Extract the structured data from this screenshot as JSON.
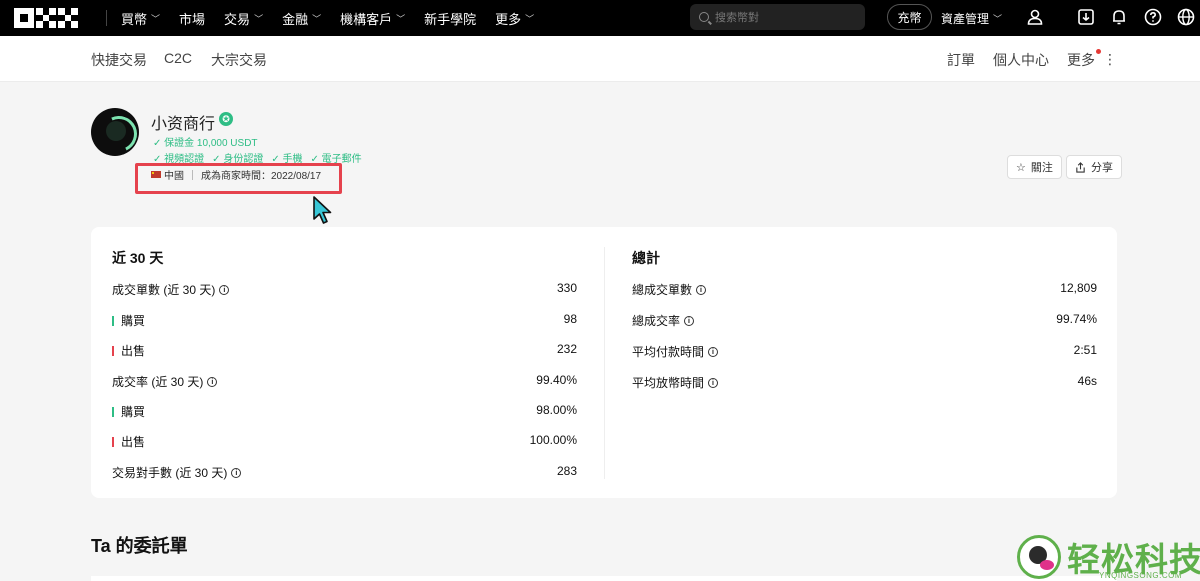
{
  "topnav": {
    "menu": [
      {
        "label": "買幣",
        "dropdown": true
      },
      {
        "label": "市場",
        "dropdown": false
      },
      {
        "label": "交易",
        "dropdown": true
      },
      {
        "label": "金融",
        "dropdown": true
      },
      {
        "label": "機構客戶",
        "dropdown": true
      },
      {
        "label": "新手學院",
        "dropdown": false
      },
      {
        "label": "更多",
        "dropdown": true
      }
    ],
    "search_placeholder": "搜索幣對",
    "deposit_label": "充幣",
    "asset_label": "資產管理",
    "icons": [
      "user-icon",
      "download-icon",
      "bell-icon",
      "help-icon",
      "globe-icon"
    ]
  },
  "subnav": {
    "left": [
      "快捷交易",
      "C2C",
      "大宗交易"
    ],
    "right": [
      "訂單",
      "個人中心",
      "更多"
    ]
  },
  "profile": {
    "name": "小资商行",
    "deposit": "✓ 保證金 10,000 USDT",
    "verifications": [
      "✓ 視頻認證",
      "✓ 身份認證",
      "✓ 手機",
      "✓ 電子郵件"
    ],
    "country": "中國",
    "merchant_since": "成為商家時間：2022/08/17",
    "follow_label": "關注",
    "share_label": "分享"
  },
  "stats": {
    "recent_title": "近 30 天",
    "total_title": "總計",
    "recent": [
      {
        "label": "成交單數 (近 30 天)",
        "value": "330",
        "info": true,
        "bar": ""
      },
      {
        "label": "購買",
        "value": "98",
        "info": false,
        "bar": "buy"
      },
      {
        "label": "出售",
        "value": "232",
        "info": false,
        "bar": "sell"
      },
      {
        "label": "成交率 (近 30 天)",
        "value": "99.40%",
        "info": true,
        "bar": ""
      },
      {
        "label": "購買",
        "value": "98.00%",
        "info": false,
        "bar": "buy"
      },
      {
        "label": "出售",
        "value": "100.00%",
        "info": false,
        "bar": "sell"
      },
      {
        "label": "交易對手數 (近 30 天)",
        "value": "283",
        "info": true,
        "bar": ""
      }
    ],
    "total": [
      {
        "label": "總成交單數",
        "value": "12,809"
      },
      {
        "label": "總成交率",
        "value": "99.74%"
      },
      {
        "label": "平均付款時間",
        "value": "2:51"
      },
      {
        "label": "平均放幣時間",
        "value": "46s"
      }
    ]
  },
  "orders_title": "Ta 的委託單",
  "watermark": {
    "text": "轻松科技",
    "sub": "YNQINGSONG.COM"
  },
  "colors": {
    "buy": "#2ebd85",
    "sell": "#e5424d",
    "highlight": "#e5424d",
    "brand_green": "#5fb04b"
  }
}
